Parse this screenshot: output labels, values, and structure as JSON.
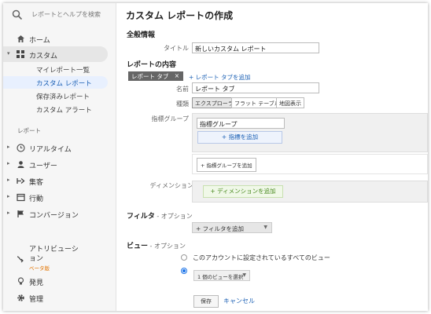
{
  "sidebar": {
    "search_placeholder": "レポートとヘルプを検索",
    "home": "ホーム",
    "custom": "カスタム",
    "sub_items": [
      "マイレポート一覧",
      "カスタム レポート",
      "保存済みレポート",
      "カスタム アラート"
    ],
    "reports_label": "レポート",
    "report_items": [
      "リアルタイム",
      "ユーザー",
      "集客",
      "行動",
      "コンバージョン"
    ],
    "attribution": "アトリビューション",
    "beta": "ベータ版",
    "discover": "発見",
    "admin": "管理"
  },
  "main": {
    "title": "カスタム レポートの作成",
    "general_heading": "全般情報",
    "title_label": "タイトル",
    "title_value": "新しいカスタム レポート",
    "content_heading": "レポートの内容",
    "tab_chip": "レポート タブ",
    "tab_close": "×",
    "add_tab": "+ レポート タブを追加",
    "name_label": "名前",
    "name_value": "レポート タブ",
    "type_label": "種類",
    "types": [
      "エクスプローラ",
      "フラット テーブル",
      "地図表示"
    ],
    "metric_group_label": "指標グループ",
    "metric_group_value": "指標グループ",
    "add_metric": "+ 指標を追加",
    "add_metric_group": "+ 指標グループを追加",
    "dimension_label": "ディメンションの詳細",
    "add_dimension": "+ ディメンションを追加",
    "filter_heading": "フィルタ",
    "filter_option": " - オプション",
    "add_filter": "+ フィルタを追加",
    "view_heading": "ビュー",
    "view_option": " - オプション",
    "view_all": "このアカウントに設定されているすべてのビュー",
    "view_select": "1 個のビューを選択",
    "save": "保存",
    "cancel": "キャンセル"
  }
}
